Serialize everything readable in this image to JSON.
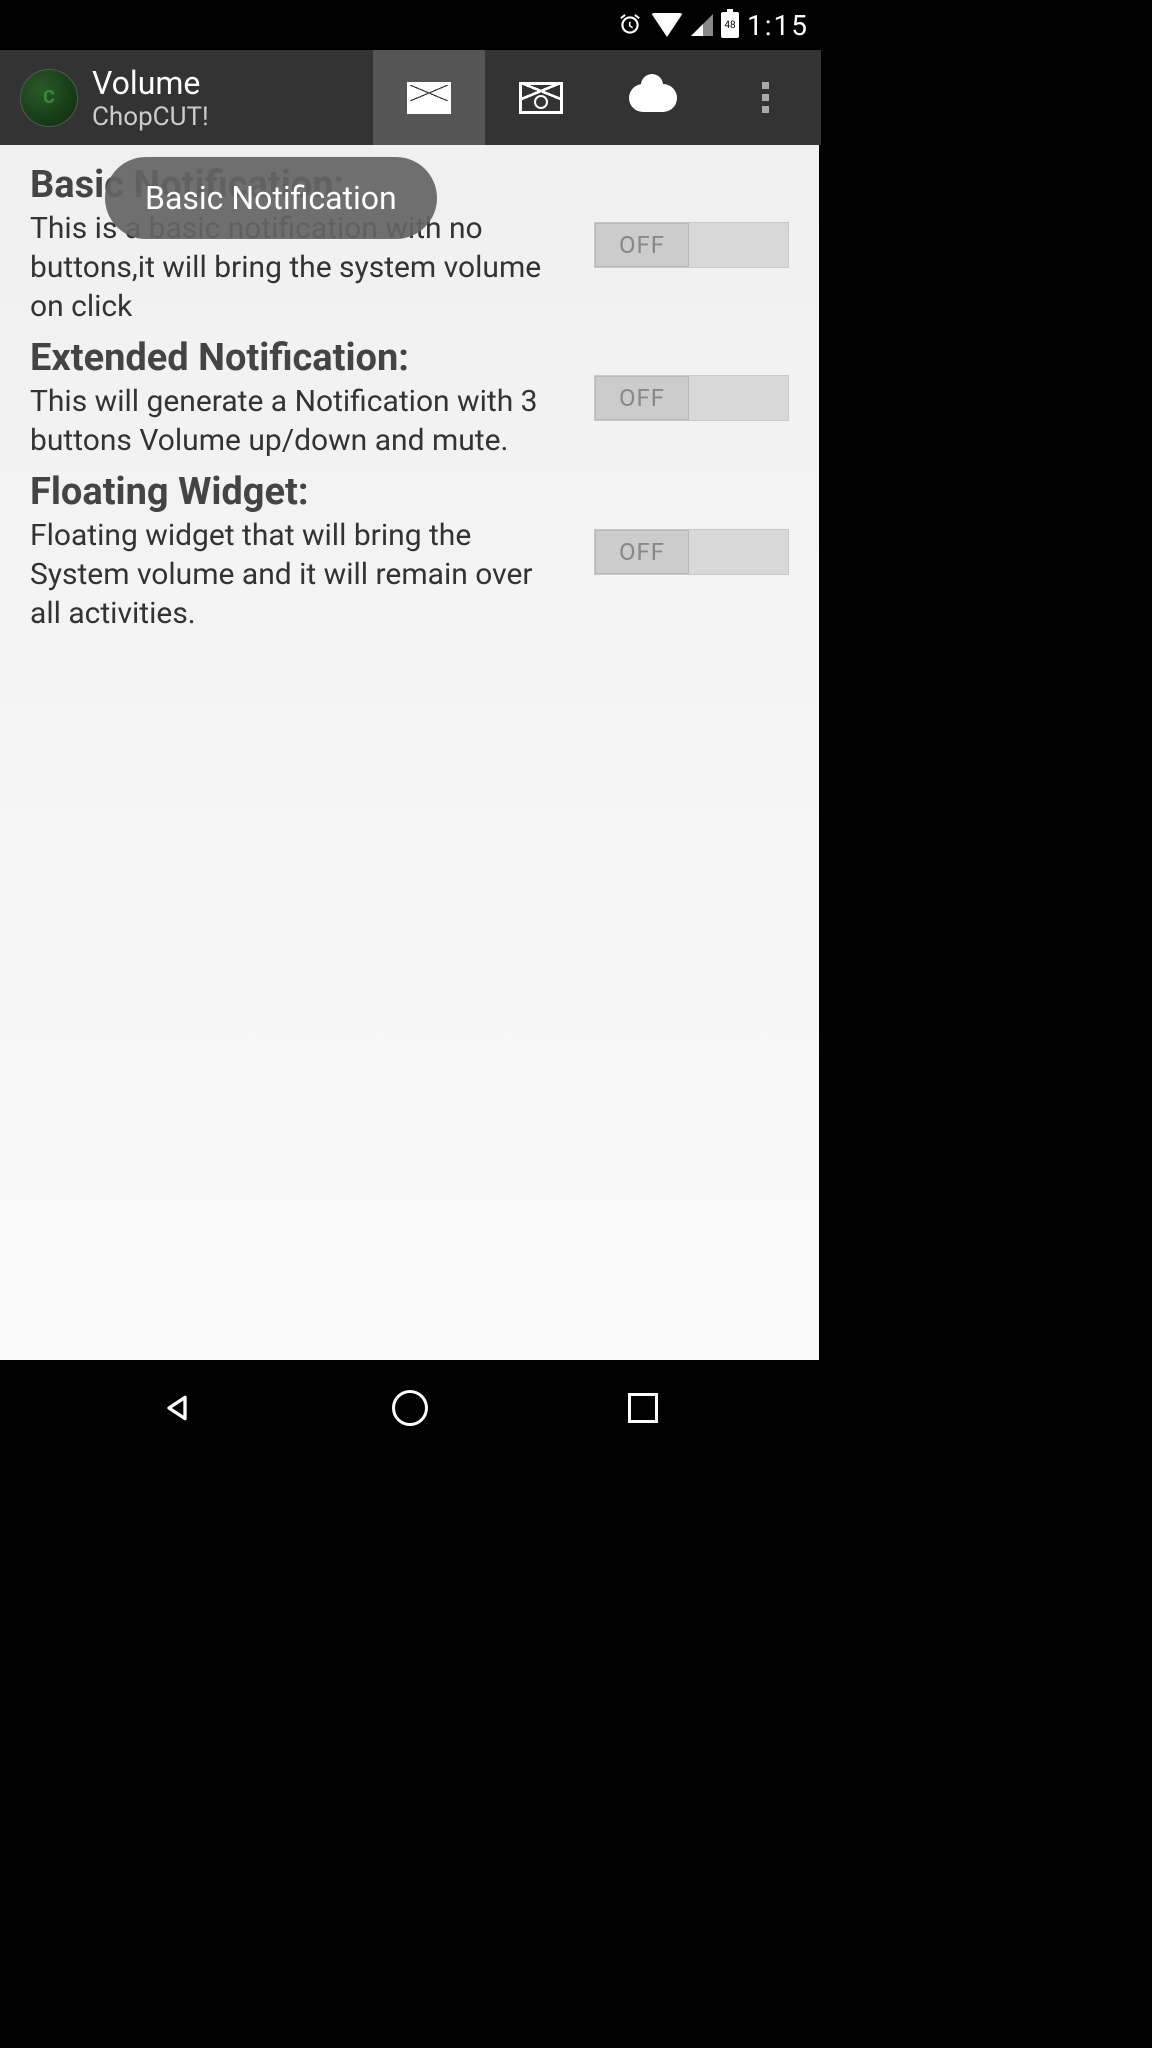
{
  "status": {
    "time": "1:15",
    "battery_level": "48"
  },
  "appbar": {
    "title": "Volume",
    "subtitle": "ChopCUT!"
  },
  "tooltip": {
    "text": "Basic Notification"
  },
  "settings": [
    {
      "title": "Basic Notification:",
      "description": "This is a basic notification with no buttons,it will bring the system volume on click",
      "toggle_state": "OFF"
    },
    {
      "title": "Extended Notification:",
      "description": "This will generate a Notification with 3 buttons Volume up/down and mute.",
      "toggle_state": "OFF"
    },
    {
      "title": "Floating Widget:",
      "description": "Floating widget that will bring the System volume and it will remain over all activities.",
      "toggle_state": "OFF"
    }
  ]
}
